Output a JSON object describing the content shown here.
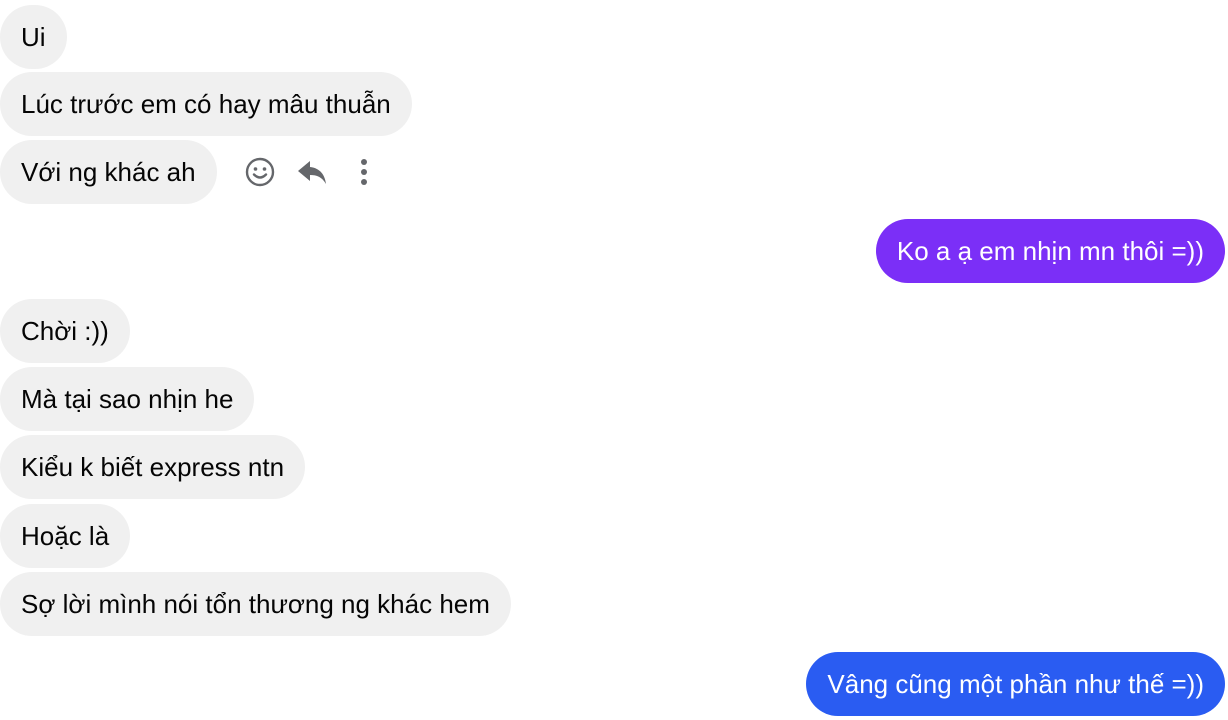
{
  "colors": {
    "incoming_bubble": "#f0f0f0",
    "incoming_text": "#050505",
    "outgoing_purple": "#7b2ff7",
    "outgoing_blue": "#2a5cf2",
    "icon": "#65676b"
  },
  "messages": [
    {
      "side": "incoming",
      "text": "Ui"
    },
    {
      "side": "incoming",
      "text": "Lúc trước em có hay mâu thuẫn"
    },
    {
      "side": "incoming",
      "text": "Với ng khác ah"
    },
    {
      "side": "outgoing",
      "text": "Ko a ạ em nhịn mn thôi =))"
    },
    {
      "side": "incoming",
      "text": "Chời :))"
    },
    {
      "side": "incoming",
      "text": "Mà tại sao nhịn he"
    },
    {
      "side": "incoming",
      "text": "Kiểu k biết express ntn"
    },
    {
      "side": "incoming",
      "text": "Hoặc là"
    },
    {
      "side": "incoming",
      "text": "Sợ lời mình nói tổn thương ng khác hem"
    },
    {
      "side": "outgoing",
      "text": "Vâng cũng một phần như thế =))"
    }
  ],
  "hover_actions": [
    {
      "icon": "smiley-face-icon",
      "label": "React"
    },
    {
      "icon": "reply-arrow-icon",
      "label": "Reply"
    },
    {
      "icon": "vertical-dots-icon",
      "label": "More"
    }
  ]
}
